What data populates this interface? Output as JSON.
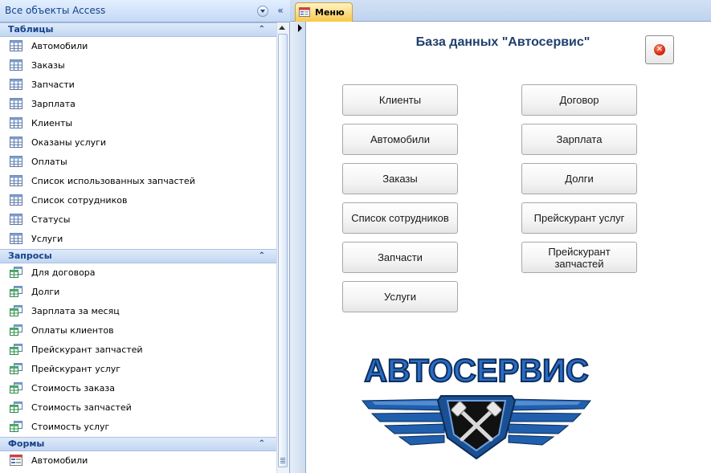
{
  "nav": {
    "title": "Все объекты Access",
    "collapse_icon": "«",
    "groups": [
      {
        "label": "Таблицы",
        "icon": "table-icon",
        "items": [
          "Автомобили",
          "Заказы",
          "Запчасти",
          "Зарплата",
          "Клиенты",
          "Оказаны услуги",
          "Оплаты",
          "Список использованных запчастей",
          "Список сотрудников",
          "Статусы",
          "Услуги"
        ]
      },
      {
        "label": "Запросы",
        "icon": "query-icon",
        "items": [
          "Для договора",
          "Долги",
          "Зарплата за месяц",
          "Оплаты клиентов",
          "Прейскурант запчастей",
          "Прейскурант услуг",
          "Стоимость заказа",
          "Стоимость запчастей",
          "Стоимость услуг"
        ]
      },
      {
        "label": "Формы",
        "icon": "form-icon",
        "items": [
          "Автомобили"
        ]
      }
    ]
  },
  "tab": {
    "label": "Меню",
    "active_color": "#f8c94c"
  },
  "form": {
    "title": "База данных \"Автосервис\"",
    "title_color": "#1f3f6e",
    "close_icon": "✕",
    "buttons_left": [
      "Клиенты",
      "Автомобили",
      "Заказы",
      "Список сотрудников",
      "Запчасти",
      "Услуги"
    ],
    "buttons_right": [
      "Договор",
      "Зарплата",
      "Долги",
      "Прейскурант услуг",
      "Прейскурант запчастей"
    ],
    "logo_text": "АВТОСЕРВИС",
    "logo_color": "#1c5fb0"
  }
}
